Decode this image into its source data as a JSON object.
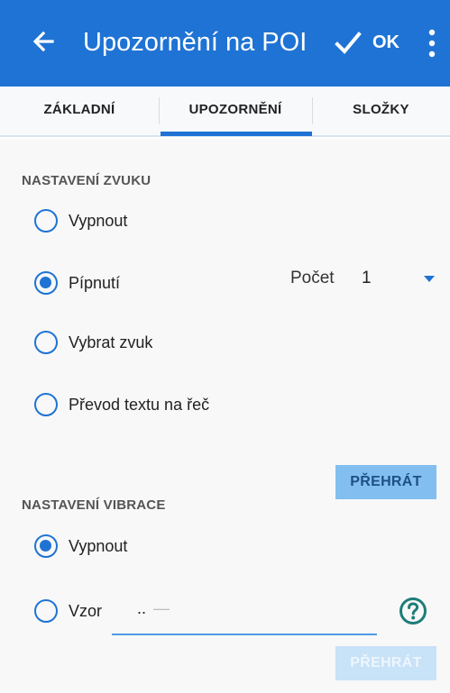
{
  "appbar": {
    "title": "Upozornění na POI",
    "ok_label": "OK",
    "color": "#1f73d4"
  },
  "tabs": [
    {
      "label": "ZÁKLADNÍ",
      "active": false
    },
    {
      "label": "UPOZORNĚNÍ",
      "active": true
    },
    {
      "label": "SLOŽKY",
      "active": false
    }
  ],
  "sound": {
    "header": "NASTAVENÍ ZVUKU",
    "options": [
      {
        "label": "Vypnout",
        "checked": false
      },
      {
        "label": "Pípnutí",
        "checked": true
      },
      {
        "label": "Vybrat zvuk",
        "checked": false
      },
      {
        "label": "Převod textu na řeč",
        "checked": false
      }
    ],
    "count_label": "Počet",
    "count_value": "1",
    "play_label": "PŘEHRÁT"
  },
  "vibration": {
    "header": "NASTAVENÍ VIBRACE",
    "options": [
      {
        "label": "Vypnout",
        "checked": true
      },
      {
        "label": "Vzor",
        "checked": false
      }
    ],
    "pattern_value": "..",
    "pattern_hint": "—",
    "play_label": "PŘEHRÁT",
    "play_enabled": false
  },
  "icons": {
    "back": "arrow-left-icon",
    "confirm": "check-icon",
    "more": "more-vert-icon",
    "help": "help-circle-icon",
    "dropdown": "triangle-down-icon"
  }
}
